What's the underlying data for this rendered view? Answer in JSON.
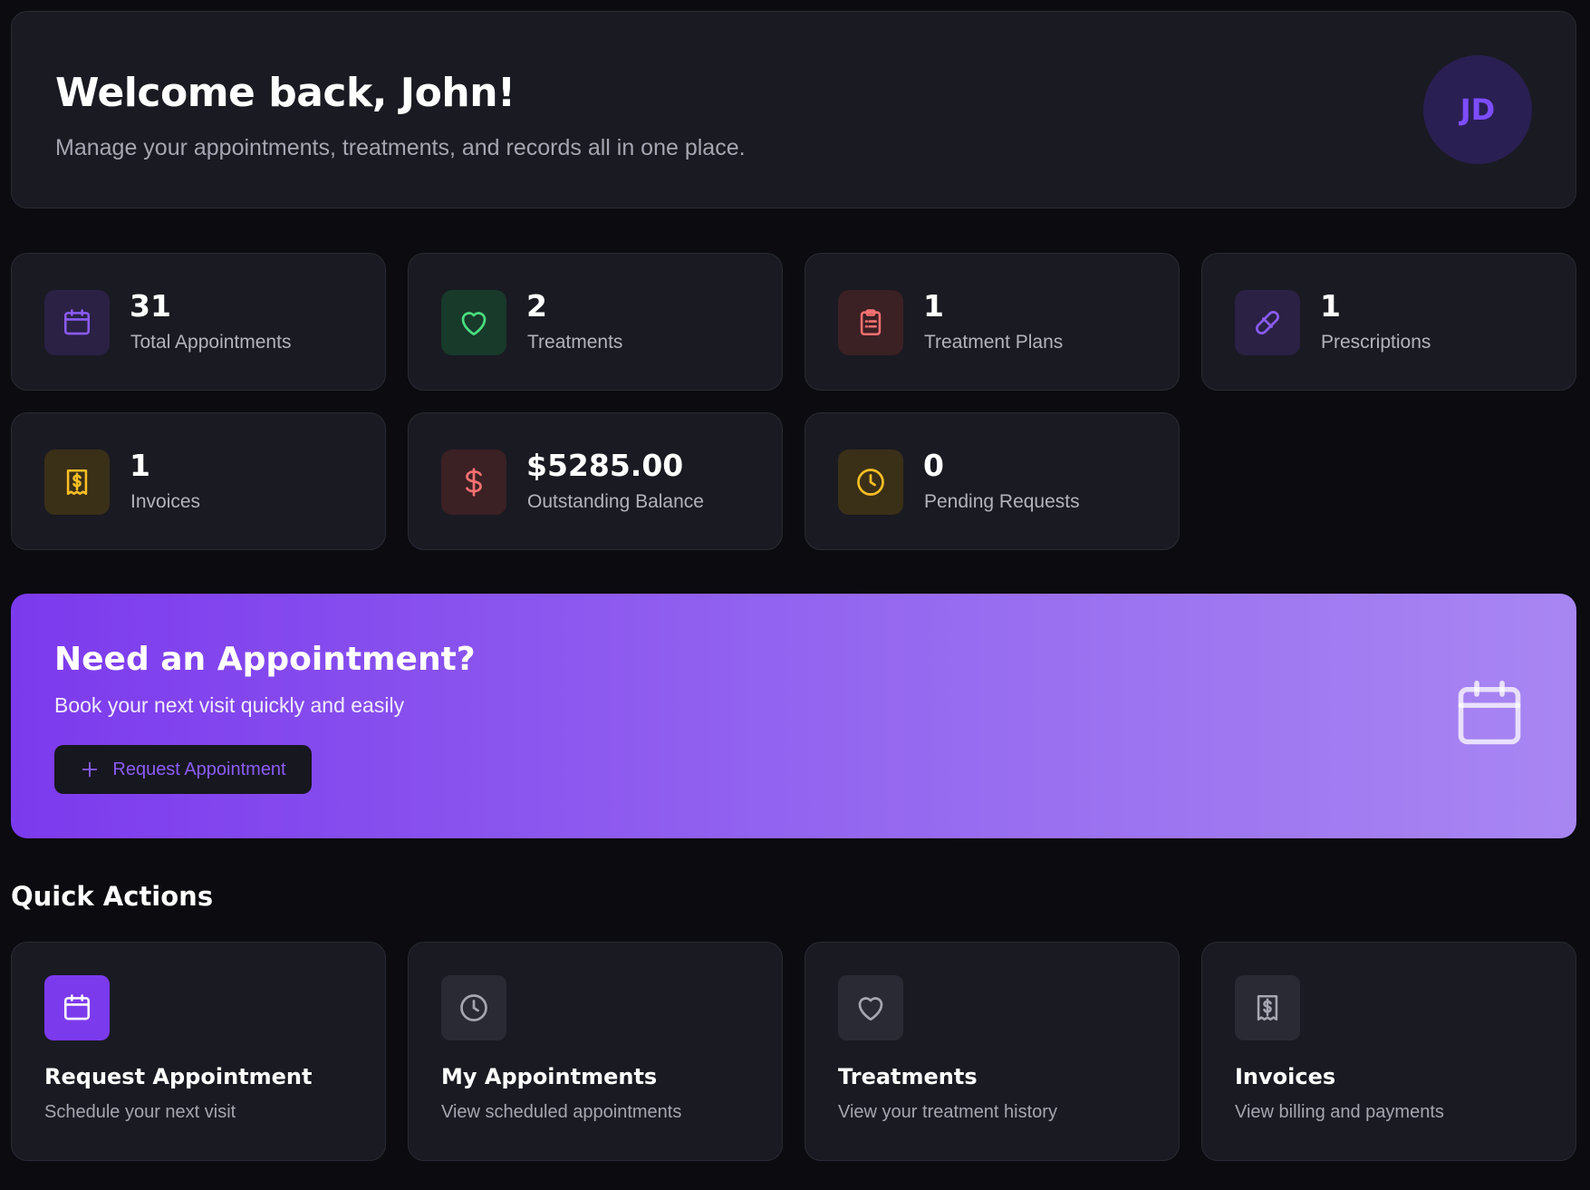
{
  "welcome": {
    "title": "Welcome back, John!",
    "subtitle": "Manage your appointments, treatments, and records all in one place.",
    "avatar_initials": "JD"
  },
  "stats": [
    {
      "value": "31",
      "label": "Total Appointments",
      "icon": "calendar-icon",
      "color": "#8b5cf6"
    },
    {
      "value": "2",
      "label": "Treatments",
      "icon": "heart-icon",
      "color": "#4ade80"
    },
    {
      "value": "1",
      "label": "Treatment Plans",
      "icon": "clipboard-list-icon",
      "color": "#f87171"
    },
    {
      "value": "1",
      "label": "Prescriptions",
      "icon": "pill-icon",
      "color": "#8b5cf6"
    },
    {
      "value": "1",
      "label": "Invoices",
      "icon": "receipt-icon",
      "color": "#fbbf24"
    },
    {
      "value": "$5285.00",
      "label": "Outstanding Balance",
      "icon": "dollar-icon",
      "color": "#f87171"
    },
    {
      "value": "0",
      "label": "Pending Requests",
      "icon": "clock-icon",
      "color": "#fbbf24"
    }
  ],
  "banner": {
    "title": "Need an Appointment?",
    "subtitle": "Book your next visit quickly and easily",
    "button_label": "Request Appointment"
  },
  "quick_actions": {
    "title": "Quick Actions",
    "items": [
      {
        "title": "Request Appointment",
        "description": "Schedule your next visit",
        "icon": "calendar-icon"
      },
      {
        "title": "My Appointments",
        "description": "View scheduled appointments",
        "icon": "clock-icon"
      },
      {
        "title": "Treatments",
        "description": "View your treatment history",
        "icon": "heart-icon"
      },
      {
        "title": "Invoices",
        "description": "View billing and payments",
        "icon": "receipt-icon"
      }
    ]
  },
  "colors": {
    "accent": "#7c3aed",
    "background": "#0b0b10",
    "card": "#1a1a22"
  }
}
